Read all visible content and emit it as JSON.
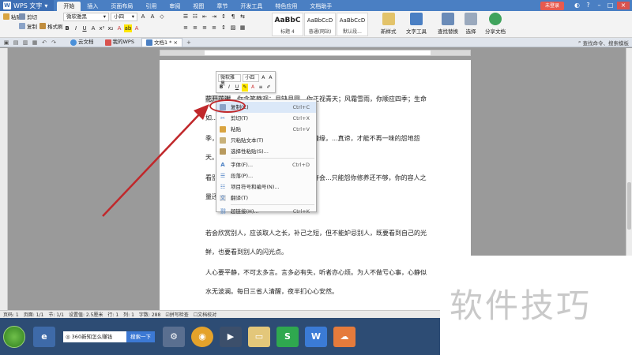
{
  "app": {
    "name": "WPS 文字"
  },
  "menu_tabs": [
    "开始",
    "插入",
    "页面布局",
    "引用",
    "审阅",
    "视图",
    "章节",
    "开发工具",
    "特色应用",
    "文档助手"
  ],
  "login_label": "未登录",
  "ribbon": {
    "cut": "剪切",
    "paste": "粘贴",
    "copy": "复制",
    "format_painter": "格式刷",
    "font_name": "微软雅黑",
    "font_size": "小四",
    "styles": [
      {
        "preview": "AaBbC",
        "name": "标题 4"
      },
      {
        "preview": "AaBbCcD",
        "name": "普通(网站)"
      },
      {
        "preview": "AaBbCcD",
        "name": "默认段..."
      }
    ],
    "new_style": "新样式",
    "text_tools": "文字工具",
    "find_replace": "查找替换",
    "select": "选择",
    "share_doc": "分享文档"
  },
  "tabs": {
    "cloud": "云文档",
    "my_wps": "我的WPS",
    "doc1": "文档1 *"
  },
  "search_command": "查找命令、搜索模板",
  "paragraphs": [
    {
      "selected": "花开花谢",
      "rest": "，你含笑静观；月缺月圆，你正视青天；风霜雪雨，你顺应四季；生命如..."
    },
    {
      "lead": "",
      "rest": "季，是与非，美与丑，爱与恨，恩仇与情缘，...真谛，才能不再一味的怨地怨天。"
    },
    {
      "lead": "",
      "rest": "看别人不顺眼，也许有些事让你烦，也许会...只能怨你修养还不够，你的容人之量还缺乏..."
    },
    {
      "lead": "",
      "rest": "若会欣赏别人，应该取人之长，补己之短，但不能妒忌别人，既要看到自己的光鲜，也要看到别人的闪光点。"
    },
    {
      "lead": "",
      "rest": "人心要平静，不可太多言。言多必有失，听者亦心烦。为人不做亏心事，心静似水无波澜。每日三省人清醒，夜半扪心心安然。"
    }
  ],
  "mini_toolbar": {
    "font_name": "微软雅黑",
    "font_size": "小四"
  },
  "context_menu": [
    {
      "label": "复制(C)",
      "shortcut": "Ctrl+C",
      "icon": "copy-icon",
      "highlight": true
    },
    {
      "label": "剪切(T)",
      "shortcut": "Ctrl+X",
      "icon": "scissors-icon"
    },
    {
      "label": "粘贴",
      "shortcut": "Ctrl+V",
      "icon": "paste-icon"
    },
    {
      "label": "只粘贴文本(T)",
      "shortcut": "",
      "icon": "text-icon"
    },
    {
      "label": "选择性粘贴(S)...",
      "shortcut": "",
      "icon": "paste-special-icon"
    },
    {
      "sep": true
    },
    {
      "label": "字体(F)...",
      "shortcut": "Ctrl+D",
      "icon": "font-icon"
    },
    {
      "label": "段落(P)...",
      "shortcut": "",
      "icon": "paragraph-icon"
    },
    {
      "label": "项目符号和编号(N)...",
      "shortcut": "",
      "icon": "list-icon"
    },
    {
      "label": "翻译(T)",
      "shortcut": "",
      "icon": "translate-icon"
    },
    {
      "sep": true
    },
    {
      "label": "超链接(H)...",
      "shortcut": "Ctrl+K",
      "icon": "link-icon"
    }
  ],
  "status": {
    "page_num": "页码: 1",
    "pages": "页面: 1/1",
    "section": "节: 1/1",
    "setting": "设置值: 2.5厘米",
    "row": "行: 1",
    "col": "列: 1",
    "wordcount": "字数: 288",
    "spellcheck": "拼写检查",
    "doc_check": "文档校对"
  },
  "taskbar": {
    "browser_label": "360新知怎么赚钱",
    "search_btn": "搜索一下"
  },
  "watermark": "软件技巧",
  "colors": {
    "titlebar": "#4a7fc3",
    "arrow": "#c0282b",
    "highlight_bg": "#dbe8f8"
  }
}
